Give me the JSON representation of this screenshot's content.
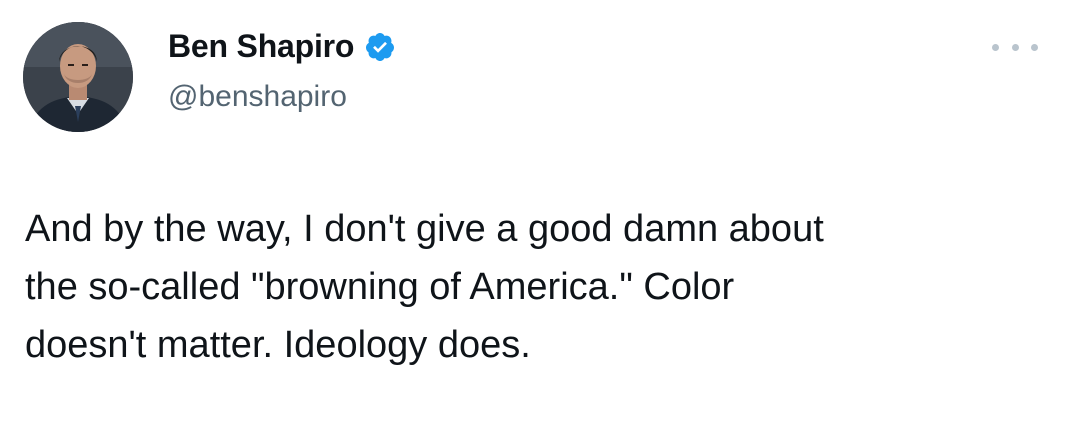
{
  "tweet": {
    "author": {
      "display_name": "Ben Shapiro",
      "handle": "@benshapiro",
      "verified": true,
      "verified_icon": "verified-badge-icon",
      "avatar": "profile-photo"
    },
    "more_icon": "more-options-icon",
    "text_lines": [
      "And by the way, I don't give a good damn about",
      "the so-called \"browning of America.\" Color",
      "doesn't matter. Ideology does."
    ]
  },
  "colors": {
    "background": "#ffffff",
    "text_primary": "#0f1419",
    "text_secondary": "#536471",
    "verified_blue": "#1d9bf0",
    "more_dots": "#b9c4cd"
  }
}
